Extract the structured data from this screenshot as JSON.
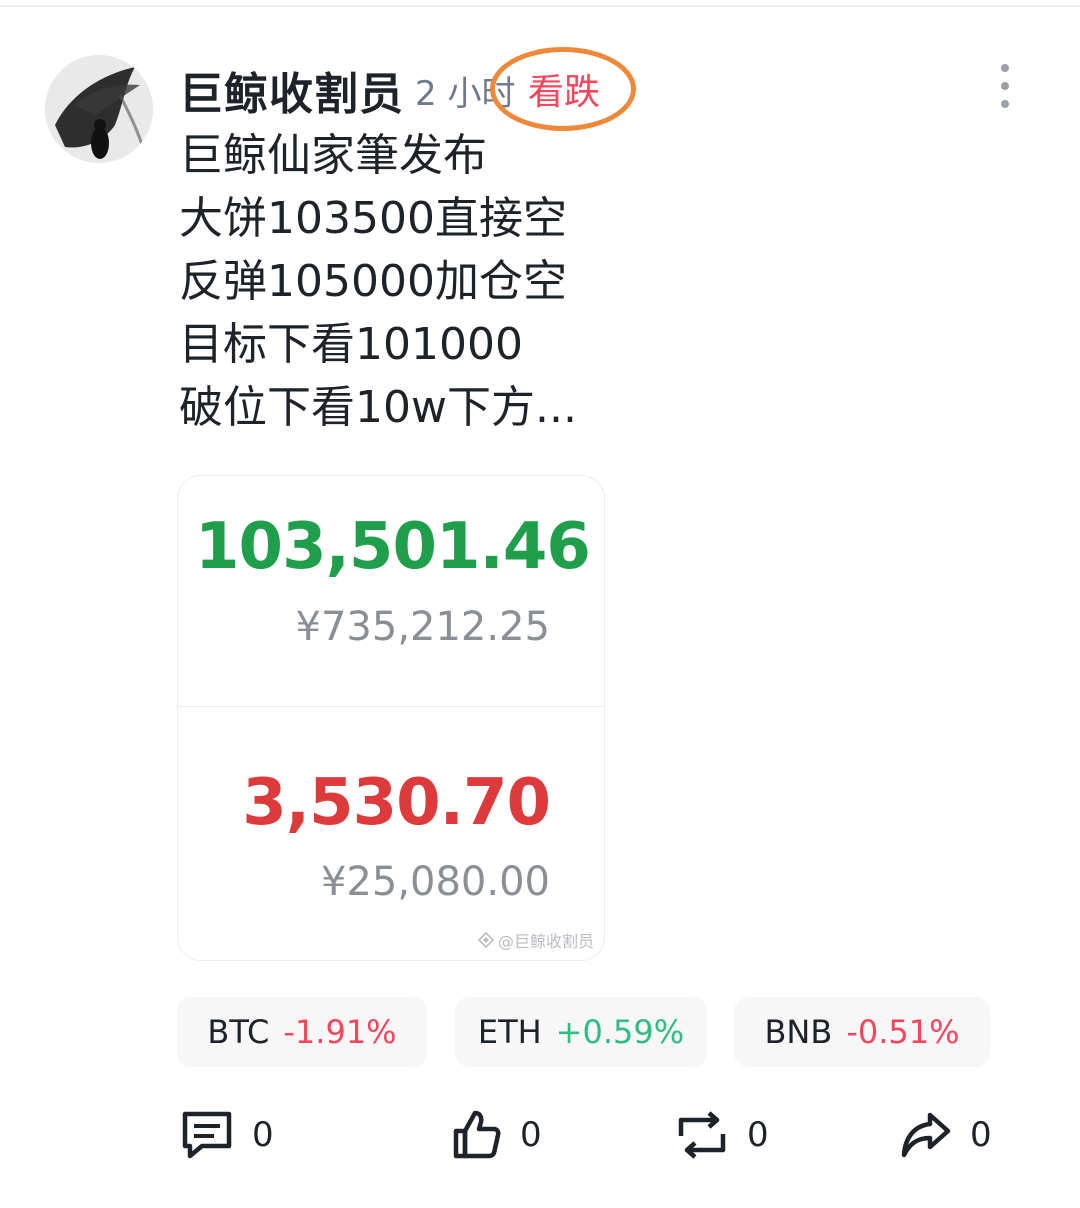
{
  "post": {
    "author": "巨鲸收割员",
    "time": "2 小时",
    "sentiment": "看跌",
    "lines": [
      "巨鲸仙家筆发布",
      "大饼103500直接空",
      "反弹105000加仓空",
      "目标下看101000",
      "破位下看10w下方..."
    ]
  },
  "quote_card": {
    "btc_price": "103,501.46",
    "btc_cny": "¥735,212.25",
    "eth_price": "3,530.70",
    "eth_cny": "¥25,080.00",
    "watermark": "@巨鲸收割员",
    "colors": {
      "up": "#1f9e4b",
      "down": "#dd3b3b"
    }
  },
  "tickers": [
    {
      "symbol": "BTC",
      "change": "-1.91%",
      "direction": "down"
    },
    {
      "symbol": "ETH",
      "change": "+0.59%",
      "direction": "up"
    },
    {
      "symbol": "BNB",
      "change": "-0.51%",
      "direction": "down"
    }
  ],
  "actions": {
    "comment_count": "0",
    "like_count": "0",
    "repost_count": "0",
    "share_count": "0"
  },
  "icons": [
    "more-vertical-icon",
    "comment-icon",
    "thumbs-up-icon",
    "repost-icon",
    "share-icon"
  ],
  "colors": {
    "bearish": "#f6465d",
    "bullish": "#2ebd85",
    "annotation": "#f0883a"
  }
}
